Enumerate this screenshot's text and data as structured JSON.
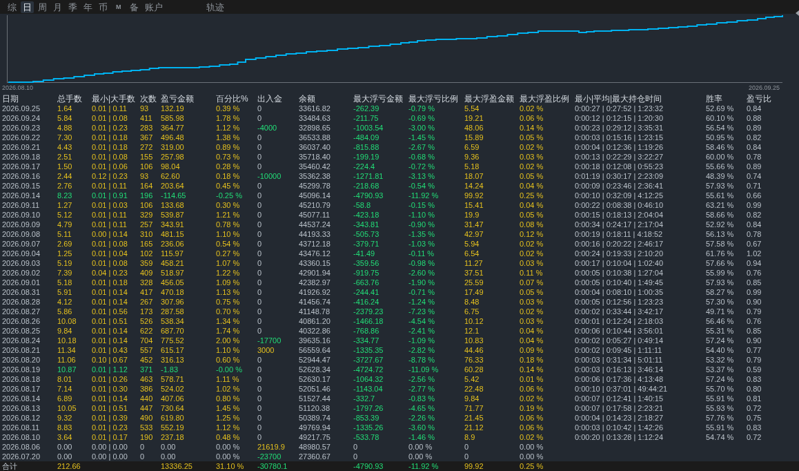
{
  "tabs": [
    {
      "label": "综",
      "kind": "word",
      "selected": false
    },
    {
      "label": "日",
      "kind": "word",
      "selected": true
    },
    {
      "label": "周",
      "kind": "word",
      "selected": false
    },
    {
      "label": "月",
      "kind": "word",
      "selected": false
    },
    {
      "label": "季",
      "kind": "word",
      "selected": false
    },
    {
      "label": "年",
      "kind": "word",
      "selected": false
    },
    {
      "label": "币",
      "kind": "word",
      "selected": false
    },
    {
      "label": "M",
      "kind": "letter",
      "selected": false
    },
    {
      "label": "备",
      "kind": "word",
      "selected": false
    },
    {
      "label": "账户",
      "kind": "word",
      "selected": false
    }
  ],
  "side_tabs": [
    {
      "label": "轨迹",
      "kind": "word",
      "selected": false
    }
  ],
  "chart": {
    "start_label": "2026.08.10",
    "end_label": "2026.09.25"
  },
  "table": {
    "columns": [
      "日期",
      "总手数",
      "最小|大手数",
      "次数",
      "盈亏金额",
      "百分比%",
      "出入金",
      "余额",
      "最大浮亏金额",
      "最大浮亏比例",
      "最大浮盈金额",
      "最大浮盈比例",
      "最小|平均|最大持仓时间",
      "胜率",
      "盈亏比"
    ],
    "rows": [
      {
        "date": "2026.09.25",
        "loss": false,
        "no_trades": false,
        "lots": "1.64",
        "lot_range": "0.01 | 0.11",
        "trades": "93",
        "pnl": "132.19",
        "pct": "0.39 %",
        "transfer": "0",
        "withdrawal": false,
        "deposit": false,
        "balance": "33616.82",
        "float_loss": "-262.39",
        "float_loss_pct": "-0.79 %",
        "float_profit": "5.54",
        "float_profit_pct": "0.02 %",
        "hold_times": "0:00:27 | 0:27:52 | 1:23:32",
        "win_rate": "52.69 %",
        "pl_ratio": "0.84"
      },
      {
        "date": "2026.09.24",
        "loss": false,
        "no_trades": false,
        "lots": "5.84",
        "lot_range": "0.01 | 0.08",
        "trades": "411",
        "pnl": "585.98",
        "pct": "1.78 %",
        "transfer": "0",
        "withdrawal": false,
        "deposit": false,
        "balance": "33484.63",
        "float_loss": "-211.75",
        "float_loss_pct": "-0.69 %",
        "float_profit": "19.21",
        "float_profit_pct": "0.06 %",
        "hold_times": "0:00:12 | 0:12:15 | 1:20:30",
        "win_rate": "60.10 %",
        "pl_ratio": "0.88"
      },
      {
        "date": "2026.09.23",
        "loss": false,
        "no_trades": false,
        "lots": "4.88",
        "lot_range": "0.01 | 0.23",
        "trades": "283",
        "pnl": "364.77",
        "pct": "1.12 %",
        "transfer": "-4000",
        "withdrawal": true,
        "balance": "32898.65",
        "float_loss": "-1003.54",
        "float_loss_pct": "-3.00 %",
        "float_profit": "48.06",
        "float_profit_pct": "0.14 %",
        "hold_times": "0:00:23 | 0:29:12 | 3:35:31",
        "win_rate": "56.54 %",
        "pl_ratio": "0.89"
      },
      {
        "date": "2026.09.22",
        "loss": false,
        "no_trades": false,
        "lots": "7.30",
        "lot_range": "0.01 | 0.18",
        "trades": "367",
        "pnl": "496.48",
        "pct": "1.38 %",
        "transfer": "0",
        "withdrawal": false,
        "deposit": false,
        "balance": "36533.88",
        "float_loss": "-484.09",
        "float_loss_pct": "-1.45 %",
        "float_profit": "15.89",
        "float_profit_pct": "0.05 %",
        "hold_times": "0:00:03 | 0:15:16 | 1:23:15",
        "win_rate": "50.95 %",
        "pl_ratio": "0.82"
      },
      {
        "date": "2026.09.21",
        "loss": false,
        "no_trades": false,
        "lots": "4.43",
        "lot_range": "0.01 | 0.18",
        "trades": "272",
        "pnl": "319.00",
        "pct": "0.89 %",
        "transfer": "0",
        "withdrawal": false,
        "deposit": false,
        "balance": "36037.40",
        "float_loss": "-815.88",
        "float_loss_pct": "-2.67 %",
        "float_profit": "6.59",
        "float_profit_pct": "0.02 %",
        "hold_times": "0:00:04 | 0:12:36 | 1:19:26",
        "win_rate": "58.46 %",
        "pl_ratio": "0.84"
      },
      {
        "date": "2026.09.18",
        "loss": false,
        "no_trades": false,
        "lots": "2.51",
        "lot_range": "0.01 | 0.08",
        "trades": "155",
        "pnl": "257.98",
        "pct": "0.73 %",
        "transfer": "0",
        "withdrawal": false,
        "deposit": false,
        "balance": "35718.40",
        "float_loss": "-199.19",
        "float_loss_pct": "-0.68 %",
        "float_profit": "9.36",
        "float_profit_pct": "0.03 %",
        "hold_times": "0:00:13 | 0:22:29 | 3:22:27",
        "win_rate": "60.00 %",
        "pl_ratio": "0.78"
      },
      {
        "date": "2026.09.17",
        "loss": false,
        "no_trades": false,
        "lots": "1.50",
        "lot_range": "0.01 | 0.06",
        "trades": "106",
        "pnl": "98.04",
        "pct": "0.28 %",
        "transfer": "0",
        "withdrawal": false,
        "deposit": false,
        "balance": "35460.42",
        "float_loss": "-224.4",
        "float_loss_pct": "-0.72 %",
        "float_profit": "5.18",
        "float_profit_pct": "0.02 %",
        "hold_times": "0:00:18 | 0:12:08 | 0:55:23",
        "win_rate": "55.66 %",
        "pl_ratio": "0.89"
      },
      {
        "date": "2026.09.16",
        "loss": false,
        "no_trades": false,
        "lots": "2.44",
        "lot_range": "0.12 | 0.23",
        "trades": "93",
        "pnl": "62.60",
        "pct": "0.18 %",
        "transfer": "-10000",
        "withdrawal": true,
        "balance": "35362.38",
        "float_loss": "-1271.81",
        "float_loss_pct": "-3.13 %",
        "float_profit": "18.07",
        "float_profit_pct": "0.05 %",
        "hold_times": "0:01:19 | 0:30:17 | 2:23:09",
        "win_rate": "48.39 %",
        "pl_ratio": "0.74"
      },
      {
        "date": "2026.09.15",
        "loss": false,
        "no_trades": false,
        "lots": "2.76",
        "lot_range": "0.01 | 0.11",
        "trades": "164",
        "pnl": "203.64",
        "pct": "0.45 %",
        "transfer": "0",
        "withdrawal": false,
        "deposit": false,
        "balance": "45299.78",
        "float_loss": "-218.68",
        "float_loss_pct": "-0.54 %",
        "float_profit": "14.24",
        "float_profit_pct": "0.04 %",
        "hold_times": "0:00:09 | 0:23:46 | 2:36:41",
        "win_rate": "57.93 %",
        "pl_ratio": "0.71"
      },
      {
        "date": "2026.09.14",
        "loss": true,
        "no_trades": false,
        "lots": "8.23",
        "lot_range": "0.01 | 0.91",
        "trades": "196",
        "pnl": "-114.65",
        "pct": "-0.25 %",
        "transfer": "0",
        "withdrawal": false,
        "deposit": false,
        "balance": "45096.14",
        "float_loss": "-4790.93",
        "float_loss_pct": "-11.92 %",
        "float_profit": "99.92",
        "float_profit_pct": "0.25 %",
        "hold_times": "0:00:10 | 0:32:09 | 4:12:25",
        "win_rate": "55.61 %",
        "pl_ratio": "0.66"
      },
      {
        "date": "2026.09.11",
        "loss": false,
        "no_trades": false,
        "lots": "1.27",
        "lot_range": "0.01 | 0.03",
        "trades": "106",
        "pnl": "133.68",
        "pct": "0.30 %",
        "transfer": "0",
        "withdrawal": false,
        "deposit": false,
        "balance": "45210.79",
        "float_loss": "-58.8",
        "float_loss_pct": "-0.15 %",
        "float_profit": "15.41",
        "float_profit_pct": "0.04 %",
        "hold_times": "0:00:22 | 0:08:38 | 0:46:10",
        "win_rate": "63.21 %",
        "pl_ratio": "0.99"
      },
      {
        "date": "2026.09.10",
        "loss": false,
        "no_trades": false,
        "lots": "5.12",
        "lot_range": "0.01 | 0.11",
        "trades": "329",
        "pnl": "539.87",
        "pct": "1.21 %",
        "transfer": "0",
        "withdrawal": false,
        "deposit": false,
        "balance": "45077.11",
        "float_loss": "-423.18",
        "float_loss_pct": "-1.10 %",
        "float_profit": "19.9",
        "float_profit_pct": "0.05 %",
        "hold_times": "0:00:15 | 0:18:13 | 2:04:04",
        "win_rate": "58.66 %",
        "pl_ratio": "0.82"
      },
      {
        "date": "2026.09.09",
        "loss": false,
        "no_trades": false,
        "lots": "4.79",
        "lot_range": "0.01 | 0.11",
        "trades": "257",
        "pnl": "343.91",
        "pct": "0.78 %",
        "transfer": "0",
        "withdrawal": false,
        "deposit": false,
        "balance": "44537.24",
        "float_loss": "-343.81",
        "float_loss_pct": "-0.90 %",
        "float_profit": "31.47",
        "float_profit_pct": "0.08 %",
        "hold_times": "0:00:34 | 0:24:17 | 2:17:04",
        "win_rate": "52.92 %",
        "pl_ratio": "0.84"
      },
      {
        "date": "2026.09.08",
        "loss": false,
        "no_trades": false,
        "lots": "5.11",
        "lot_range": "0.00 | 0.14",
        "trades": "310",
        "pnl": "481.15",
        "pct": "1.10 %",
        "transfer": "0",
        "withdrawal": false,
        "deposit": false,
        "balance": "44193.33",
        "float_loss": "-505.73",
        "float_loss_pct": "-1.35 %",
        "float_profit": "42.97",
        "float_profit_pct": "0.12 %",
        "hold_times": "0:00:19 | 0:18:11 | 4:18:52",
        "win_rate": "56.13 %",
        "pl_ratio": "0.78"
      },
      {
        "date": "2026.09.07",
        "loss": false,
        "no_trades": false,
        "lots": "2.69",
        "lot_range": "0.01 | 0.08",
        "trades": "165",
        "pnl": "236.06",
        "pct": "0.54 %",
        "transfer": "0",
        "withdrawal": false,
        "deposit": false,
        "balance": "43712.18",
        "float_loss": "-379.71",
        "float_loss_pct": "-1.03 %",
        "float_profit": "5.94",
        "float_profit_pct": "0.02 %",
        "hold_times": "0:00:16 | 0:20:22 | 2:46:17",
        "win_rate": "57.58 %",
        "pl_ratio": "0.67"
      },
      {
        "date": "2026.09.04",
        "loss": false,
        "no_trades": false,
        "lots": "1.25",
        "lot_range": "0.01 | 0.04",
        "trades": "102",
        "pnl": "115.97",
        "pct": "0.27 %",
        "transfer": "0",
        "withdrawal": false,
        "deposit": false,
        "balance": "43476.12",
        "float_loss": "-41.49",
        "float_loss_pct": "-0.11 %",
        "float_profit": "6.54",
        "float_profit_pct": "0.02 %",
        "hold_times": "0:00:24 | 0:19:33 | 2:10:20",
        "win_rate": "61.76 %",
        "pl_ratio": "1.02"
      },
      {
        "date": "2026.09.03",
        "loss": false,
        "no_trades": false,
        "lots": "5.19",
        "lot_range": "0.01 | 0.08",
        "trades": "359",
        "pnl": "458.21",
        "pct": "1.07 %",
        "transfer": "0",
        "withdrawal": false,
        "deposit": false,
        "balance": "43360.15",
        "float_loss": "-359.56",
        "float_loss_pct": "-0.98 %",
        "float_profit": "11.27",
        "float_profit_pct": "0.03 %",
        "hold_times": "0:00:17 | 0:10:04 | 1:02:40",
        "win_rate": "57.66 %",
        "pl_ratio": "0.94"
      },
      {
        "date": "2026.09.02",
        "loss": false,
        "no_trades": false,
        "lots": "7.39",
        "lot_range": "0.04 | 0.23",
        "trades": "409",
        "pnl": "518.97",
        "pct": "1.22 %",
        "transfer": "0",
        "withdrawal": false,
        "deposit": false,
        "balance": "42901.94",
        "float_loss": "-919.75",
        "float_loss_pct": "-2.60 %",
        "float_profit": "37.51",
        "float_profit_pct": "0.11 %",
        "hold_times": "0:00:05 | 0:10:38 | 1:27:04",
        "win_rate": "55.99 %",
        "pl_ratio": "0.76"
      },
      {
        "date": "2026.09.01",
        "loss": false,
        "no_trades": false,
        "lots": "5.18",
        "lot_range": "0.01 | 0.18",
        "trades": "328",
        "pnl": "456.05",
        "pct": "1.09 %",
        "transfer": "0",
        "withdrawal": false,
        "deposit": false,
        "balance": "42382.97",
        "float_loss": "-663.76",
        "float_loss_pct": "-1.90 %",
        "float_profit": "25.59",
        "float_profit_pct": "0.07 %",
        "hold_times": "0:00:05 | 0:10:40 | 1:49:45",
        "win_rate": "57.93 %",
        "pl_ratio": "0.85"
      },
      {
        "date": "2026.08.31",
        "loss": false,
        "no_trades": false,
        "lots": "5.91",
        "lot_range": "0.01 | 0.14",
        "trades": "417",
        "pnl": "470.18",
        "pct": "1.13 %",
        "transfer": "0",
        "withdrawal": false,
        "deposit": false,
        "balance": "41926.92",
        "float_loss": "-244.41",
        "float_loss_pct": "-0.71 %",
        "float_profit": "17.49",
        "float_profit_pct": "0.05 %",
        "hold_times": "0:00:04 | 0:08:10 | 1:00:35",
        "win_rate": "58.27 %",
        "pl_ratio": "0.99"
      },
      {
        "date": "2026.08.28",
        "loss": false,
        "no_trades": false,
        "lots": "4.12",
        "lot_range": "0.01 | 0.14",
        "trades": "267",
        "pnl": "307.96",
        "pct": "0.75 %",
        "transfer": "0",
        "withdrawal": false,
        "deposit": false,
        "balance": "41456.74",
        "float_loss": "-416.24",
        "float_loss_pct": "-1.24 %",
        "float_profit": "8.48",
        "float_profit_pct": "0.03 %",
        "hold_times": "0:00:05 | 0:12:56 | 1:23:23",
        "win_rate": "57.30 %",
        "pl_ratio": "0.90"
      },
      {
        "date": "2026.08.27",
        "loss": false,
        "no_trades": false,
        "lots": "5.86",
        "lot_range": "0.01 | 0.56",
        "trades": "173",
        "pnl": "287.58",
        "pct": "0.70 %",
        "transfer": "0",
        "withdrawal": false,
        "deposit": false,
        "balance": "41148.78",
        "float_loss": "-2379.23",
        "float_loss_pct": "-7.23 %",
        "float_profit": "6.75",
        "float_profit_pct": "0.02 %",
        "hold_times": "0:00:02 | 0:33:44 | 3:42:17",
        "win_rate": "49.71 %",
        "pl_ratio": "0.79"
      },
      {
        "date": "2026.08.26",
        "loss": false,
        "no_trades": false,
        "lots": "10.08",
        "lot_range": "0.01 | 0.51",
        "trades": "526",
        "pnl": "538.34",
        "pct": "1.34 %",
        "transfer": "0",
        "withdrawal": false,
        "deposit": false,
        "balance": "40861.20",
        "float_loss": "-1466.18",
        "float_loss_pct": "-4.54 %",
        "float_profit": "10.12",
        "float_profit_pct": "0.03 %",
        "hold_times": "0:00:01 | 0:12:24 | 2:18:03",
        "win_rate": "56.46 %",
        "pl_ratio": "0.76"
      },
      {
        "date": "2026.08.25",
        "loss": false,
        "no_trades": false,
        "lots": "9.84",
        "lot_range": "0.01 | 0.14",
        "trades": "622",
        "pnl": "687.70",
        "pct": "1.74 %",
        "transfer": "0",
        "withdrawal": false,
        "deposit": false,
        "balance": "40322.86",
        "float_loss": "-768.86",
        "float_loss_pct": "-2.41 %",
        "float_profit": "12.1",
        "float_profit_pct": "0.04 %",
        "hold_times": "0:00:06 | 0:10:44 | 3:56:01",
        "win_rate": "55.31 %",
        "pl_ratio": "0.85"
      },
      {
        "date": "2026.08.24",
        "loss": false,
        "no_trades": false,
        "lots": "10.18",
        "lot_range": "0.01 | 0.14",
        "trades": "704",
        "pnl": "775.52",
        "pct": "2.00 %",
        "transfer": "-17700",
        "withdrawal": true,
        "balance": "39635.16",
        "float_loss": "-334.77",
        "float_loss_pct": "-1.09 %",
        "float_profit": "10.83",
        "float_profit_pct": "0.04 %",
        "hold_times": "0:00:02 | 0:05:27 | 0:49:14",
        "win_rate": "57.24 %",
        "pl_ratio": "0.90"
      },
      {
        "date": "2026.08.21",
        "loss": false,
        "no_trades": false,
        "lots": "11.34",
        "lot_range": "0.01 | 0.43",
        "trades": "557",
        "pnl": "615.17",
        "pct": "1.10 %",
        "transfer": "3000",
        "withdrawal": false,
        "deposit": true,
        "balance": "56559.64",
        "float_loss": "-1335.35",
        "float_loss_pct": "-2.82 %",
        "float_profit": "44.46",
        "float_profit_pct": "0.09 %",
        "hold_times": "0:00:02 | 0:09:45 | 1:11:11",
        "win_rate": "54.40 %",
        "pl_ratio": "0.77"
      },
      {
        "date": "2026.08.20",
        "loss": false,
        "no_trades": false,
        "lots": "11.06",
        "lot_range": "0.10 | 0.67",
        "trades": "452",
        "pnl": "316.13",
        "pct": "0.60 %",
        "transfer": "0",
        "withdrawal": false,
        "deposit": false,
        "balance": "52944.47",
        "float_loss": "-3727.67",
        "float_loss_pct": "-8.78 %",
        "float_profit": "76.33",
        "float_profit_pct": "0.18 %",
        "hold_times": "0:00:03 | 0:31:34 | 5:01:11",
        "win_rate": "53.32 %",
        "pl_ratio": "0.79"
      },
      {
        "date": "2026.08.19",
        "loss": true,
        "no_trades": false,
        "lots": "10.87",
        "lot_range": "0.01 | 1.12",
        "trades": "371",
        "pnl": "-1.83",
        "pct": "-0.00 %",
        "transfer": "0",
        "withdrawal": false,
        "deposit": false,
        "balance": "52628.34",
        "float_loss": "-4724.72",
        "float_loss_pct": "-11.09 %",
        "float_profit": "60.28",
        "float_profit_pct": "0.14 %",
        "hold_times": "0:00:03 | 0:16:13 | 3:46:14",
        "win_rate": "53.37 %",
        "pl_ratio": "0.59"
      },
      {
        "date": "2026.08.18",
        "loss": false,
        "no_trades": false,
        "lots": "8.01",
        "lot_range": "0.01 | 0.26",
        "trades": "463",
        "pnl": "578.71",
        "pct": "1.11 %",
        "transfer": "0",
        "withdrawal": false,
        "deposit": false,
        "balance": "52630.17",
        "float_loss": "-1064.32",
        "float_loss_pct": "-2.56 %",
        "float_profit": "5.42",
        "float_profit_pct": "0.01 %",
        "hold_times": "0:00:06 | 0:17:36 | 4:13:48",
        "win_rate": "57.24 %",
        "pl_ratio": "0.83"
      },
      {
        "date": "2026.08.17",
        "loss": false,
        "no_trades": false,
        "lots": "7.14",
        "lot_range": "0.01 | 0.30",
        "trades": "386",
        "pnl": "524.02",
        "pct": "1.02 %",
        "transfer": "0",
        "withdrawal": false,
        "deposit": false,
        "balance": "52051.46",
        "float_loss": "-1143.04",
        "float_loss_pct": "-2.77 %",
        "float_profit": "22.48",
        "float_profit_pct": "0.06 %",
        "hold_times": "0:00:10 | 0:37:01 | 49:44:21",
        "win_rate": "55.70 %",
        "pl_ratio": "0.80"
      },
      {
        "date": "2026.08.14",
        "loss": false,
        "no_trades": false,
        "lots": "6.89",
        "lot_range": "0.01 | 0.14",
        "trades": "440",
        "pnl": "407.06",
        "pct": "0.80 %",
        "transfer": "0",
        "withdrawal": false,
        "deposit": false,
        "balance": "51527.44",
        "float_loss": "-332.7",
        "float_loss_pct": "-0.83 %",
        "float_profit": "9.84",
        "float_profit_pct": "0.02 %",
        "hold_times": "0:00:07 | 0:12:41 | 1:40:15",
        "win_rate": "55.91 %",
        "pl_ratio": "0.81"
      },
      {
        "date": "2026.08.13",
        "loss": false,
        "no_trades": false,
        "lots": "10.05",
        "lot_range": "0.01 | 0.51",
        "trades": "447",
        "pnl": "730.64",
        "pct": "1.45 %",
        "transfer": "0",
        "withdrawal": false,
        "deposit": false,
        "balance": "51120.38",
        "float_loss": "-1797.26",
        "float_loss_pct": "-4.65 %",
        "float_profit": "71.77",
        "float_profit_pct": "0.19 %",
        "hold_times": "0:00:07 | 0:17:58 | 2:23:21",
        "win_rate": "55.93 %",
        "pl_ratio": "0.72"
      },
      {
        "date": "2026.08.12",
        "loss": false,
        "no_trades": false,
        "lots": "9.32",
        "lot_range": "0.01 | 0.39",
        "trades": "490",
        "pnl": "619.80",
        "pct": "1.25 %",
        "transfer": "0",
        "withdrawal": false,
        "deposit": false,
        "balance": "50389.74",
        "float_loss": "-853.39",
        "float_loss_pct": "-2.26 %",
        "float_profit": "21.45",
        "float_profit_pct": "0.06 %",
        "hold_times": "0:00:04 | 0:14:23 | 2:18:27",
        "win_rate": "57.76 %",
        "pl_ratio": "0.75"
      },
      {
        "date": "2026.08.11",
        "loss": false,
        "no_trades": false,
        "lots": "8.83",
        "lot_range": "0.01 | 0.23",
        "trades": "533",
        "pnl": "552.19",
        "pct": "1.12 %",
        "transfer": "0",
        "withdrawal": false,
        "deposit": false,
        "balance": "49769.94",
        "float_loss": "-1335.26",
        "float_loss_pct": "-3.60 %",
        "float_profit": "21.12",
        "float_profit_pct": "0.06 %",
        "hold_times": "0:00:03 | 0:10:42 | 1:42:26",
        "win_rate": "55.91 %",
        "pl_ratio": "0.83"
      },
      {
        "date": "2026.08.10",
        "loss": false,
        "no_trades": false,
        "lots": "3.64",
        "lot_range": "0.01 | 0.17",
        "trades": "190",
        "pnl": "237.18",
        "pct": "0.48 %",
        "transfer": "0",
        "withdrawal": false,
        "deposit": false,
        "balance": "49217.75",
        "float_loss": "-533.78",
        "float_loss_pct": "-1.46 %",
        "float_profit": "8.9",
        "float_profit_pct": "0.02 %",
        "hold_times": "0:00:20 | 0:13:28 | 1:12:24",
        "win_rate": "54.74 %",
        "pl_ratio": "0.72"
      },
      {
        "date": "2026.08.06",
        "no_trades": true,
        "lots": "0.00",
        "lot_range": "0.00 | 0.00",
        "trades": "0",
        "pnl": "0.00",
        "pct": "0.00 %",
        "transfer": "21619.9",
        "withdrawal": false,
        "deposit": true,
        "balance": "48980.57",
        "float_loss": "0",
        "float_loss_pct": "0.00 %",
        "float_profit": "0",
        "float_profit_pct": "0.00 %"
      },
      {
        "date": "2026.07.20",
        "no_trades": true,
        "lots": "0.00",
        "lot_range": "0.00 | 0.00",
        "trades": "0",
        "pnl": "0.00",
        "pct": "0.00 %",
        "transfer": "-23700",
        "withdrawal": true,
        "balance": "27360.67",
        "float_loss": "0",
        "float_loss_pct": "0.00 %",
        "float_profit": "0",
        "float_profit_pct": "0.00 %"
      }
    ],
    "total": {
      "label": "合计",
      "loss": false,
      "no_trades": false,
      "lots": "212.66",
      "pnl": "13336.25",
      "pct": "31.10 %",
      "transfer": "-30780.1",
      "withdrawal": true,
      "float_loss": "-4790.93",
      "float_loss_pct": "-11.92 %",
      "float_profit": "99.92",
      "float_profit_pct": "0.25 %"
    }
  }
}
